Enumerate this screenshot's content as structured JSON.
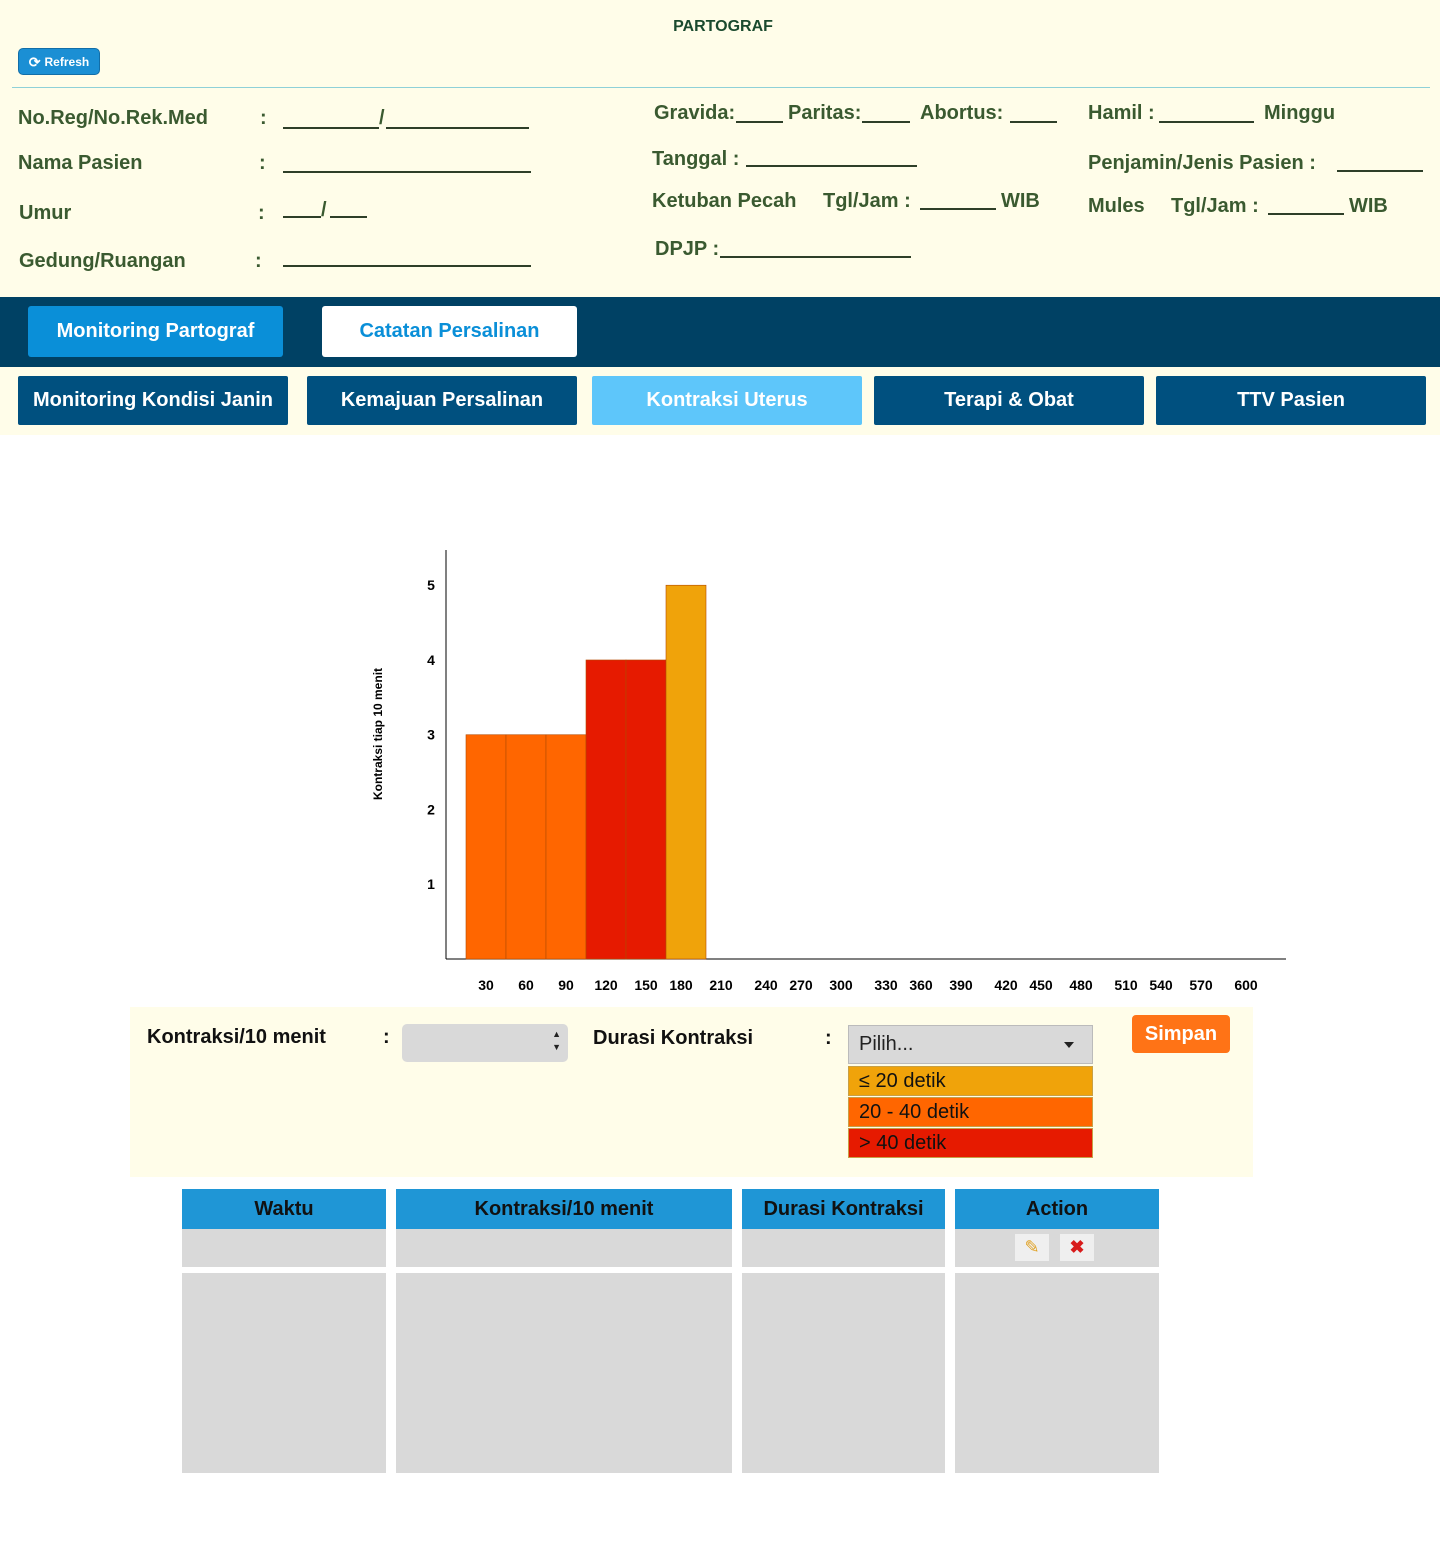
{
  "header": {
    "title": "PARTOGRAF",
    "refresh_label": "Refresh",
    "left_fields": [
      {
        "label": "No.Reg/No.Rek.Med",
        "colon": ":"
      },
      {
        "label": "Nama Pasien",
        "colon": ":"
      },
      {
        "label": "Umur",
        "colon": ":"
      },
      {
        "label": "Gedung/Ruangan",
        "colon": ":"
      }
    ],
    "gravida": "Gravida:",
    "paritas": "Paritas:",
    "abortus": "Abortus:",
    "hamil": "Hamil :",
    "minggu": "Minggu",
    "tanggal": "Tanggal :",
    "penjamin": "Penjamin/Jenis Pasien  :",
    "ketuban": "Ketuban Pecah",
    "tgljam": "Tgl/Jam  :",
    "wib": "WIB",
    "mules": "Mules",
    "dpjp": "DPJP :",
    "slash": "/"
  },
  "nav": {
    "tabs": [
      {
        "label": "Monitoring Partograf",
        "active": true
      },
      {
        "label": "Catatan Persalinan",
        "active": false
      }
    ]
  },
  "subtabs": [
    {
      "label": "Monitoring  Kondisi Janin"
    },
    {
      "label": "Kemajuan Persalinan"
    },
    {
      "label": "Kontraksi Uterus",
      "selected": true
    },
    {
      "label": "Terapi & Obat"
    },
    {
      "label": "TTV Pasien"
    }
  ],
  "chart_data": {
    "type": "bar",
    "ylabel": "Kontraksi tiap 10 menit",
    "xlabel": "",
    "title": "",
    "ylim": [
      0,
      5.4
    ],
    "y_ticks": [
      1,
      2,
      3,
      4,
      5
    ],
    "x_ticks": [
      30,
      60,
      90,
      120,
      150,
      180,
      210,
      240,
      270,
      300,
      330,
      360,
      390,
      420,
      450,
      480,
      510,
      540,
      570,
      600
    ],
    "categories": [
      30,
      60,
      90,
      120,
      150,
      180
    ],
    "values": [
      3,
      3,
      3,
      4,
      4,
      5
    ],
    "colors": [
      "#ff6600",
      "#ff6600",
      "#ff6600",
      "#e61a00",
      "#e61a00",
      "#f0a30a"
    ],
    "grid": false
  },
  "form": {
    "kontraksi_label": "Kontraksi/10 menit",
    "durasi_label": "Durasi Kontraksi",
    "colon": ":",
    "select_placeholder": "Pilih...",
    "options": [
      {
        "label": "≤ 20 detik",
        "color": "#f0a30a"
      },
      {
        "label": "20 - 40 detik",
        "color": "#ff6600"
      },
      {
        "label": "> 40 detik",
        "color": "#e61a00"
      }
    ],
    "save_label": "Simpan"
  },
  "table": {
    "headers": [
      "Waktu",
      "Kontraksi/10 menit",
      "Durasi Kontraksi",
      "Action"
    ]
  },
  "icons": {
    "refresh": "refresh-icon",
    "edit": "edit-icon",
    "delete": "delete-icon"
  }
}
